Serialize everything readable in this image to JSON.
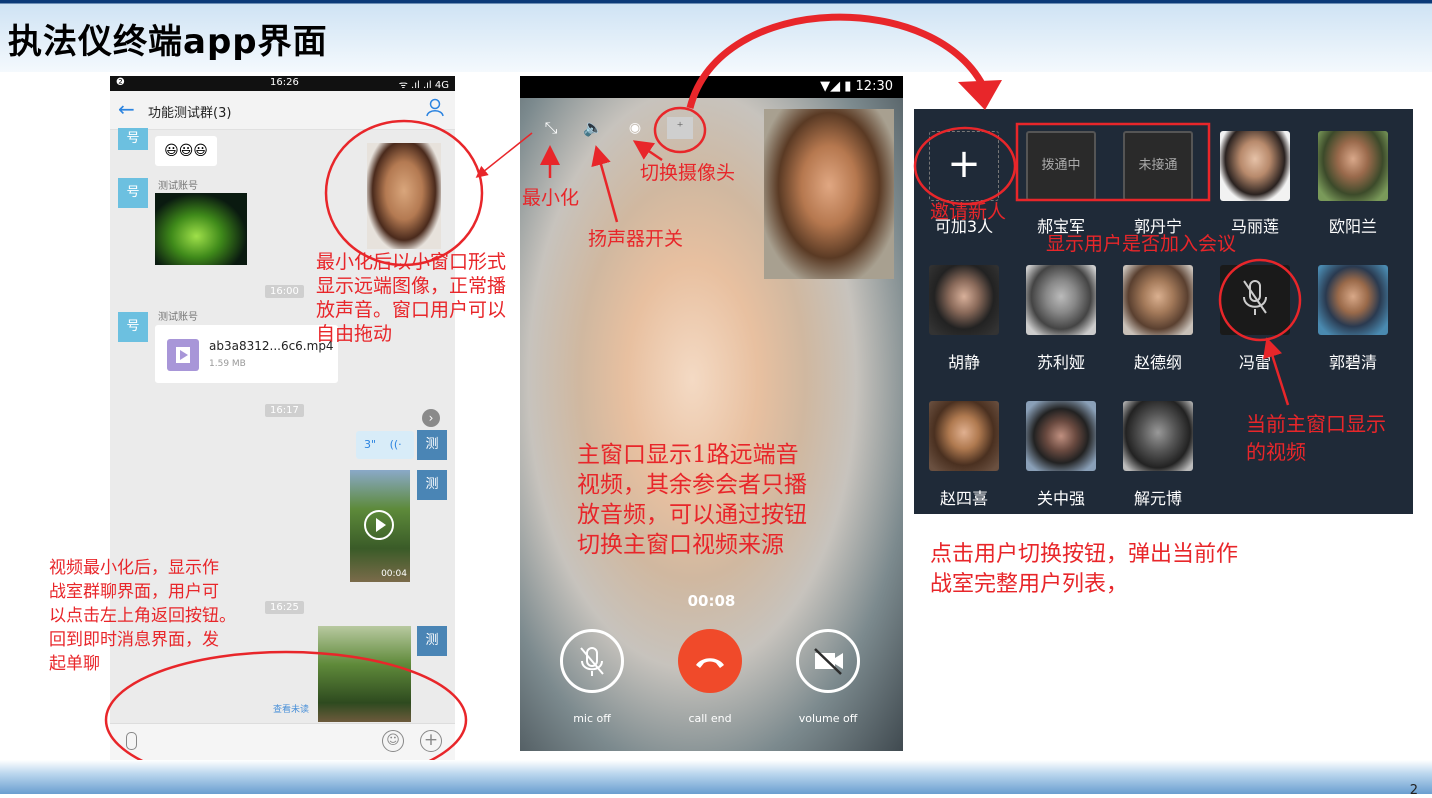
{
  "page": {
    "title": "执法仪终端app界面",
    "page_number": "2"
  },
  "phone1": {
    "status_bar": {
      "left": "❷",
      "time": "16:26",
      "right": "ᯤ .ıl .ıl 4G"
    },
    "nav": {
      "title": "功能测试群(3)",
      "back_icon": "arrow-left-icon",
      "user_icon": "user-icon"
    },
    "messages": {
      "avatar_label": "号",
      "sender": "测试账号",
      "emoji": "😃😃😃",
      "time1": "16:00",
      "time2": "16:17",
      "time3": "16:25",
      "file_name": "ab3a8312...6c6.mp4",
      "file_size": "1.59 MB",
      "voice_len": "3\"",
      "my_label": "测",
      "video_len": "00:04",
      "read_status": "查看未读"
    }
  },
  "phone2": {
    "status_time": "▼◢ ▮ 12:30",
    "timer": "00:08",
    "buttons": {
      "mic": "mic off",
      "end": "call end",
      "volume": "volume off"
    }
  },
  "panel3": {
    "invite_label": "可加3人",
    "tile_calling": "拨通中",
    "tile_not_connected": "未接通",
    "users_row1": [
      "郝宝军",
      "郭丹宁",
      "马丽莲",
      "欧阳兰"
    ],
    "users_row2": [
      "胡静",
      "苏利娅",
      "赵德纲",
      "冯雷",
      "郭碧清"
    ],
    "users_row3": [
      "赵四喜",
      "关中强",
      "解元博"
    ]
  },
  "annotations": {
    "minimize": "最小化",
    "speaker": "扬声器开关",
    "switch_camera": "切换摄像头",
    "invite": "邀请新人",
    "joined": "显示用户是否加入会议",
    "small_window": [
      "最小化后以小窗口形式",
      "显示远端图像，正常播",
      "放声音。窗口用户可以",
      "自由拖动"
    ],
    "main_window": [
      "主窗口显示1路远端音",
      "视频，其余参会者只播",
      "放音频，可以通过按钮",
      "切换主窗口视频来源"
    ],
    "current_video": [
      "当前主窗口显示",
      "的视频"
    ],
    "chat_back": [
      "视频最小化后，显示作",
      "战室群聊界面，用户可",
      "以点击左上角返回按钮。",
      "回到即时消息界面，发",
      "起单聊"
    ],
    "user_list": [
      "点击用户切换按钮，弹出当前作",
      "战室完整用户列表，"
    ]
  },
  "colors": {
    "annotation_red": "#e8262a",
    "end_call": "#f04a2a",
    "chat_blue": "#6cc0e0",
    "header_navy": "#0b3a78"
  }
}
